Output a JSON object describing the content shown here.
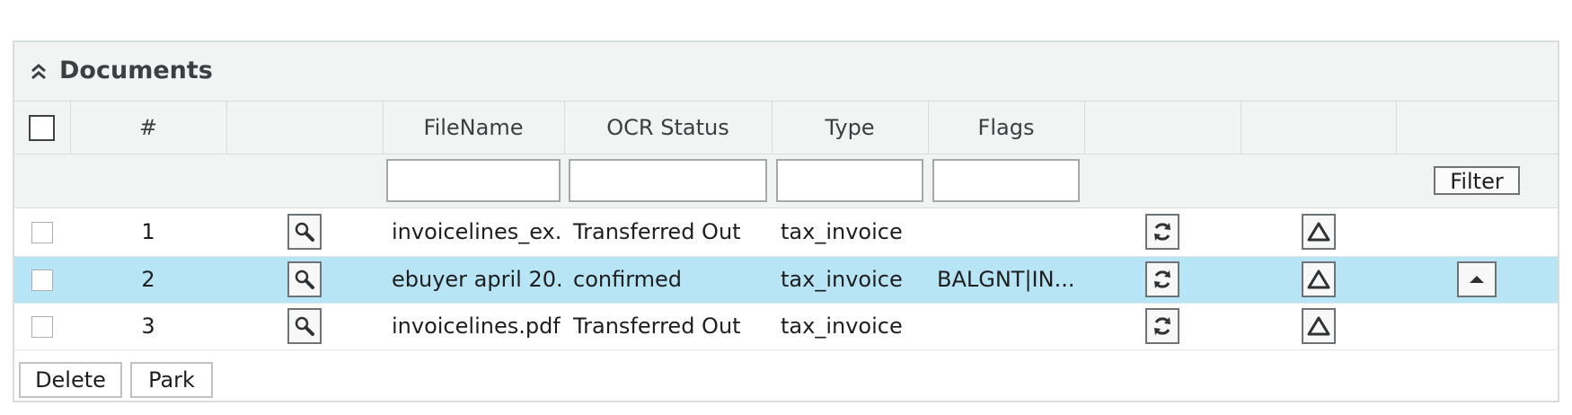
{
  "panel": {
    "title": "Documents",
    "collapse_icon": "double-chevron-up-icon"
  },
  "table": {
    "columns": [
      "",
      "#",
      "",
      "FileName",
      "OCR Status",
      "Type",
      "Flags",
      "",
      "",
      ""
    ],
    "filter_button_label": "Filter",
    "rows": [
      {
        "num": "1",
        "filename": "invoicelines_ex...",
        "ocr_status": "Transferred Out",
        "type": "tax_invoice",
        "flags": "",
        "selected": false
      },
      {
        "num": "2",
        "filename": "ebuyer april 20...",
        "ocr_status": "confirmed",
        "type": "tax_invoice",
        "flags": "BALGNT|IN...",
        "selected": true
      },
      {
        "num": "3",
        "filename": "invoicelines.pdf",
        "ocr_status": "Transferred Out",
        "type": "tax_invoice",
        "flags": "",
        "selected": false
      }
    ],
    "icons": {
      "view": "magnifier-icon",
      "refresh": "refresh-icon",
      "warning": "triangle-icon",
      "move_up": "caret-up-icon"
    }
  },
  "footer": {
    "delete_label": "Delete",
    "park_label": "Park"
  },
  "colors": {
    "header_bg": "#f2f3f3",
    "selected_row_bg": "#b7e5f6",
    "border": "#d9dcdc"
  }
}
